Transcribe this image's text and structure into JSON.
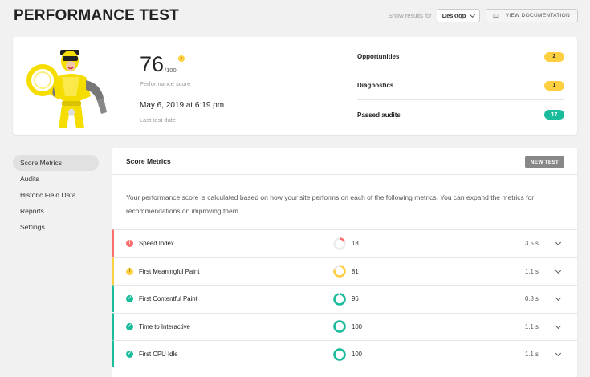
{
  "header": {
    "title": "PERFORMANCE TEST",
    "show_results_label": "Show results for",
    "device_value": "Desktop",
    "doc_button_label": "VIEW DOCUMENTATION"
  },
  "summary": {
    "score": "76",
    "score_max": "/100",
    "score_label": "Performance score",
    "test_date": "May 6, 2019 at 6:19 pm",
    "test_date_label": "Last test date",
    "audits": [
      {
        "label": "Opportunities",
        "count": "2",
        "status": "warning"
      },
      {
        "label": "Diagnostics",
        "count": "1",
        "status": "warning"
      },
      {
        "label": "Passed audits",
        "count": "17",
        "status": "success"
      }
    ]
  },
  "sidebar": {
    "items": [
      {
        "label": "Score Metrics",
        "active": true
      },
      {
        "label": "Audits",
        "active": false
      },
      {
        "label": "Historic Field Data",
        "active": false
      },
      {
        "label": "Reports",
        "active": false
      },
      {
        "label": "Settings",
        "active": false
      }
    ]
  },
  "metrics": {
    "title": "Score Metrics",
    "new_test_label": "NEW TEST",
    "intro": "Your performance score is calculated based on how your site performs on each of the following metrics. You can expand the metrics for recommendations on improving them.",
    "rows": [
      {
        "name": "Speed Index",
        "score": "18",
        "time": "3.5 s",
        "status": "error",
        "score_fraction": 0.18
      },
      {
        "name": "First Meaningful Paint",
        "score": "81",
        "time": "1.1 s",
        "status": "warning",
        "score_fraction": 0.81
      },
      {
        "name": "First Contentful Paint",
        "score": "96",
        "time": "0.8 s",
        "status": "success",
        "score_fraction": 0.96
      },
      {
        "name": "Time to Interactive",
        "score": "100",
        "time": "1.1 s",
        "status": "success",
        "score_fraction": 1.0
      },
      {
        "name": "First CPU Idle",
        "score": "100",
        "time": "1.1 s",
        "status": "success",
        "score_fraction": 1.0
      }
    ]
  },
  "colors": {
    "error": "#ff6d6d",
    "warning": "#fecf40",
    "success": "#1abc9c"
  }
}
